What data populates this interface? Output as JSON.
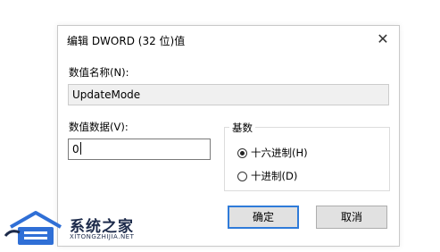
{
  "dialog": {
    "title": "编辑 DWORD (32 位)值",
    "close_glyph": "✕",
    "name_label": "数值名称(N):",
    "name_value": "UpdateMode",
    "data_label": "数值数据(V):",
    "data_value": "0",
    "base_group_title": "基数",
    "radio_hex_label": "十六进制(H)",
    "radio_dec_label": "十进制(D)",
    "selected_base": "hex",
    "ok_label": "确定",
    "cancel_label": "取消"
  },
  "watermark": {
    "name": "系统之家",
    "url": "XITONGZHIJIA.NET",
    "icon": "house-logo-icon",
    "colors": {
      "blue": "#2f6fd6",
      "dark": "#1c2a4a"
    }
  },
  "colors": {
    "accent": "#2f7bd9",
    "button_bg": "#e1e1e1",
    "readonly_bg": "#f0f0f0"
  }
}
